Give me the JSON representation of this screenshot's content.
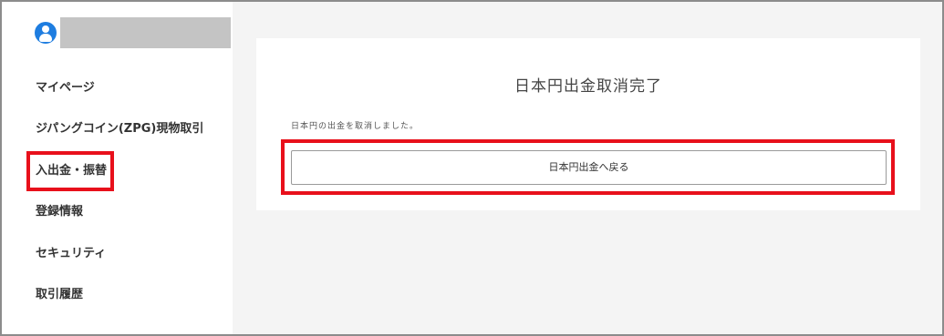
{
  "sidebar": {
    "items": [
      {
        "label": "マイページ"
      },
      {
        "label": "ジパングコイン(ZPG)現物取引"
      },
      {
        "label": "入出金・振替"
      },
      {
        "label": "登録情報"
      },
      {
        "label": "セキュリティ"
      },
      {
        "label": "取引履歴"
      }
    ]
  },
  "main": {
    "title": "日本円出金取消完了",
    "message": "日本円の出金を取消しました。",
    "back_button_label": "日本円出金へ戻る"
  },
  "colors": {
    "highlight": "#e8101b",
    "avatar": "#1e7de0",
    "background": "#f4f4f4"
  },
  "icons": {
    "avatar": "user-avatar-icon"
  }
}
